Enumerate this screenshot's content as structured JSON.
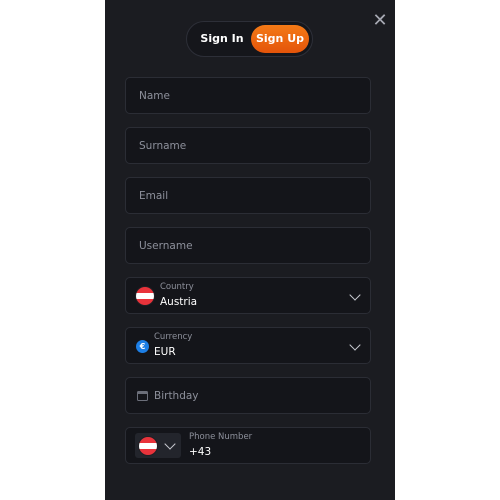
{
  "modal": {
    "close_symbol": "✕",
    "tabs": [
      {
        "label": "Sign In",
        "active": false
      },
      {
        "label": "Sign Up",
        "active": true
      }
    ]
  },
  "form": {
    "name_placeholder": "Name",
    "surname_placeholder": "Surname",
    "email_placeholder": "Email",
    "username_placeholder": "Username",
    "country": {
      "label": "Country",
      "value": "Austria",
      "flag_icon": "austria-flag-icon"
    },
    "currency": {
      "label": "Currency",
      "value": "EUR",
      "icon_symbol": "€"
    },
    "birthday_placeholder": "Birthday",
    "phone": {
      "label": "Phone Number",
      "value": "+43",
      "flag_icon": "austria-flag-icon"
    }
  },
  "colors": {
    "accent": "#f26d12",
    "panel_bg": "#1b1c21",
    "field_bg": "#14151a"
  }
}
